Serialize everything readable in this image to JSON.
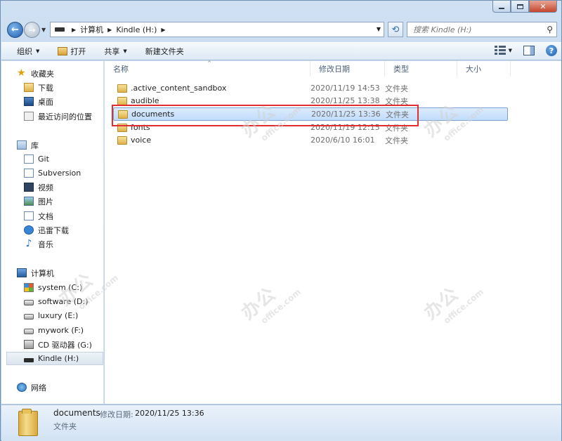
{
  "window": {
    "caption_buttons": {
      "min": "—",
      "max": "□",
      "close": "✕"
    }
  },
  "navigation": {
    "back": "←",
    "forward": "→",
    "history": "▼",
    "breadcrumb": [
      "计算机",
      "Kindle (H:)"
    ],
    "separator": "▶",
    "dropdown": "▼",
    "refresh": "⟲",
    "search_placeholder": "搜索 Kindle (H:)",
    "search_icon": "magnifier-icon"
  },
  "toolbar": {
    "organize": "组织",
    "open": "打开",
    "share": "共享",
    "new_folder": "新建文件夹",
    "arrow": "▼",
    "help": "?"
  },
  "sidebar": {
    "favorites": {
      "label": "收藏夹",
      "items": [
        {
          "label": "下载",
          "icon": "download-folder-icon"
        },
        {
          "label": "桌面",
          "icon": "desktop-icon"
        },
        {
          "label": "最近访问的位置",
          "icon": "recent-places-icon"
        }
      ]
    },
    "libraries": {
      "label": "库",
      "items": [
        {
          "label": "Git",
          "icon": "library-doc-icon"
        },
        {
          "label": "Subversion",
          "icon": "library-doc-icon"
        },
        {
          "label": "视频",
          "icon": "video-icon"
        },
        {
          "label": "图片",
          "icon": "picture-icon"
        },
        {
          "label": "文档",
          "icon": "document-icon"
        },
        {
          "label": "迅雷下载",
          "icon": "thunder-icon"
        },
        {
          "label": "音乐",
          "icon": "music-icon"
        }
      ]
    },
    "computer": {
      "label": "计算机",
      "items": [
        {
          "label": "system (C:)",
          "icon": "windows-drive-icon"
        },
        {
          "label": "software (D:)",
          "icon": "drive-icon"
        },
        {
          "label": "luxury (E:)",
          "icon": "drive-icon"
        },
        {
          "label": "mywork (F:)",
          "icon": "drive-icon"
        },
        {
          "label": "CD 驱动器 (G:)",
          "icon": "cd-drive-icon"
        },
        {
          "label": "Kindle (H:)",
          "icon": "removable-drive-icon"
        }
      ]
    },
    "network": {
      "label": "网络"
    }
  },
  "columns": {
    "name": "名称",
    "modified": "修改日期",
    "type": "类型",
    "size": "大小",
    "sort_arrow": "^"
  },
  "files": [
    {
      "name": ".active_content_sandbox",
      "modified": "2020/11/19 14:53",
      "type": "文件夹"
    },
    {
      "name": "audible",
      "modified": "2020/11/25 13:38",
      "type": "文件夹"
    },
    {
      "name": "documents",
      "modified": "2020/11/25 13:36",
      "type": "文件夹"
    },
    {
      "name": "fonts",
      "modified": "2020/11/19 12:15",
      "type": "文件夹"
    },
    {
      "name": "voice",
      "modified": "2020/6/10 16:01",
      "type": "文件夹"
    }
  ],
  "details": {
    "name": "documents",
    "modified_label": "修改日期:",
    "modified_value": "2020/11/25 13:36",
    "type": "文件夹"
  },
  "watermark": {
    "main": "办公",
    "sub": "office.com"
  }
}
